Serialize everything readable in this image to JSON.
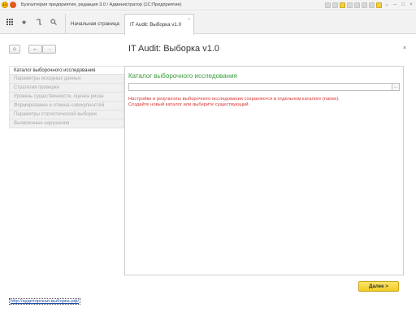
{
  "window": {
    "title": "Бухгалтерия предприятия, редакция 3.0 / Администратор (1С:Предприятие)"
  },
  "toolbar": {
    "icons": [
      "apps-grid-icon",
      "star-icon",
      "history-icon",
      "search-icon"
    ]
  },
  "tabs": [
    {
      "label": "Начальная страница"
    },
    {
      "label": "IT Audit: Выборка v1.0"
    }
  ],
  "form": {
    "title": "IT Audit: Выборка v1.0",
    "back_glyph": "←",
    "forward_glyph": "→",
    "home_glyph": "⌂",
    "close_glyph": "×"
  },
  "nav": {
    "items": [
      {
        "label": "Каталог выборочного исследования"
      },
      {
        "label": "Параметры исходных данных"
      },
      {
        "label": "Стратегия проверки"
      },
      {
        "label": "Уровень существенности, оценка риска"
      },
      {
        "label": "Формирование и отмена совокупностей"
      },
      {
        "label": "Параметры статистической выборки"
      },
      {
        "label": "Выявленные нарушения"
      }
    ]
  },
  "main": {
    "section_title": "Каталог выборочного исследования",
    "path_value": "",
    "pick_glyph": "...",
    "hint_line1": "Настройки и результаты выборочного исследования сохраняются в отдельном каталоге (папке).",
    "hint_line2": "Создайте новый каталог или выберите существующий."
  },
  "footer": {
    "next_label": "Далее >",
    "link_text": "http://аудиторская-выборка.рф/"
  },
  "colors": {
    "accent_green": "#3a9d3a",
    "hint_red": "#d8322d",
    "next_button": "#f1cc23",
    "link_blue": "#1f4fa6"
  }
}
